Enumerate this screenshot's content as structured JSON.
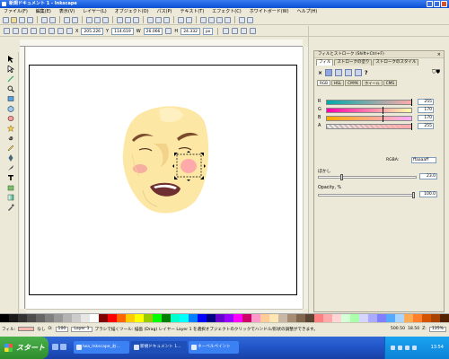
{
  "window": {
    "title": "新規ドキュメント 1 - Inkscape"
  },
  "menubar": {
    "items": [
      "ファイル(F)",
      "編集(E)",
      "表示(V)",
      "レイヤー(L)",
      "オブジェクト(O)",
      "パス(P)",
      "テキスト(T)",
      "エフェクト(C)",
      "ホワイトボード(W)",
      "ヘルプ(H)"
    ]
  },
  "toolbar": {
    "x_label": "X",
    "x_value": "205.226",
    "y_label": "Y",
    "y_value": "114.619",
    "w_label": "W",
    "w_value": "26.066",
    "h_label": "H",
    "h_value": "24.332",
    "unit": "px"
  },
  "panel": {
    "title": "フィルとストローク (Shift+Ctrl+F)",
    "close_label": "×",
    "tabs": [
      "フィル",
      "ストロークの塗り",
      "ストロークのスタイル"
    ],
    "unknown_label": "?",
    "subtabs": [
      "RGB",
      "HSL",
      "CMYK",
      "ホイール",
      "CMS"
    ],
    "channels": [
      {
        "label": "R",
        "value": "255"
      },
      {
        "label": "G",
        "value": "170"
      },
      {
        "label": "B",
        "value": "170"
      },
      {
        "label": "A",
        "value": "255"
      }
    ],
    "rgba_label": "RGBA:",
    "rgba_value": "ffaaaaff",
    "blur_label": "ぼかし",
    "blur_value": "23.0",
    "opacity_label": "Opacity, %",
    "opacity_value": "100.0"
  },
  "statusbar": {
    "fill_label": "フィル:",
    "stroke_label": "なし",
    "opacity_label": "O:",
    "opacity_value": "100",
    "layer_value": "Layer 1",
    "message": "ブラシで描くツール: 描画 (Drag) レイヤー Layer 1 を選択オブジェクトのクリックでハンドル/形状の調整ができます。",
    "coords_x": "500.50",
    "coords_y": "18.50",
    "zoom_label": "Z:",
    "zoom_value": "135%"
  },
  "taskbar": {
    "start_label": "スタート",
    "buttons": [
      "Iwa_Inkscape_お...",
      "新規ドキュメント 1...",
      "ネーベルペイント"
    ],
    "clock": "13:54"
  },
  "palette": [
    "#000000",
    "#1a1a1a",
    "#333333",
    "#4d4d4d",
    "#666666",
    "#808080",
    "#999999",
    "#b3b3b3",
    "#cccccc",
    "#e6e6e6",
    "#ffffff",
    "#800000",
    "#ff0000",
    "#ff6600",
    "#ffcc00",
    "#ffff00",
    "#99cc00",
    "#00ff00",
    "#008000",
    "#00ffcc",
    "#00ffff",
    "#0080ff",
    "#0000ff",
    "#000080",
    "#6600cc",
    "#9900ff",
    "#ff00ff",
    "#cc0066",
    "#ff99cc",
    "#ffcc99",
    "#ffe6b3",
    "#c8b7a6",
    "#a68c74",
    "#80664d",
    "#5c4433",
    "#ff8080",
    "#ffaaaa",
    "#ffd5d5",
    "#d5ffd5",
    "#aaffaa",
    "#d5d5ff",
    "#aaaaff",
    "#8080ff",
    "#55aaff",
    "#aad5ff",
    "#ffaa55",
    "#ff7f2a",
    "#d45500",
    "#aa4400",
    "#552200"
  ]
}
